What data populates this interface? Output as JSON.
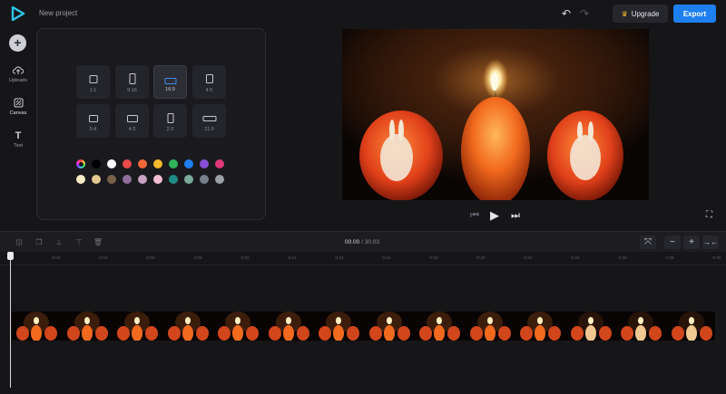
{
  "header": {
    "project_name": "New project",
    "upgrade_label": "Upgrade",
    "export_label": "Export",
    "accent_color": "#1d7ff0"
  },
  "rail": {
    "items": [
      {
        "label": "Uploads",
        "icon": "upload-cloud-icon"
      },
      {
        "label": "Canvas",
        "icon": "canvas-icon"
      },
      {
        "label": "Text",
        "icon": "text-icon"
      }
    ]
  },
  "canvas_panel": {
    "ratios": [
      {
        "label": "1:1",
        "selected": false
      },
      {
        "label": "9:16",
        "selected": false
      },
      {
        "label": "16:9",
        "selected": true
      },
      {
        "label": "4:5",
        "selected": false
      },
      {
        "label": "5:4",
        "selected": false
      },
      {
        "label": "4:3",
        "selected": false
      },
      {
        "label": "2:3",
        "selected": false
      },
      {
        "label": "21:9",
        "selected": false
      }
    ],
    "colors_row1": [
      "#000000",
      "#ffffff",
      "#e84a4a",
      "#f2683a",
      "#f5b82e",
      "#2fb35a",
      "#1f7ef0",
      "#8a4fd8",
      "#e0397a"
    ],
    "colors_row2": [
      "#f6ecc6",
      "#e5c890",
      "#77614a",
      "#8f6f9a",
      "#c7a3c4",
      "#f2bdd0",
      "#1e8a86",
      "#79aa9a",
      "#77828f",
      "#9aa0a6"
    ]
  },
  "timeline": {
    "current_time": "00.00",
    "total_time": "30.03",
    "ruler_ticks": [
      "0:02",
      "0:04",
      "0:06",
      "0:08",
      "0:10",
      "0:12",
      "0:14",
      "0:16",
      "0:18",
      "0:20",
      "0:22",
      "0:24",
      "0:26",
      "0:28",
      "0:30"
    ]
  }
}
